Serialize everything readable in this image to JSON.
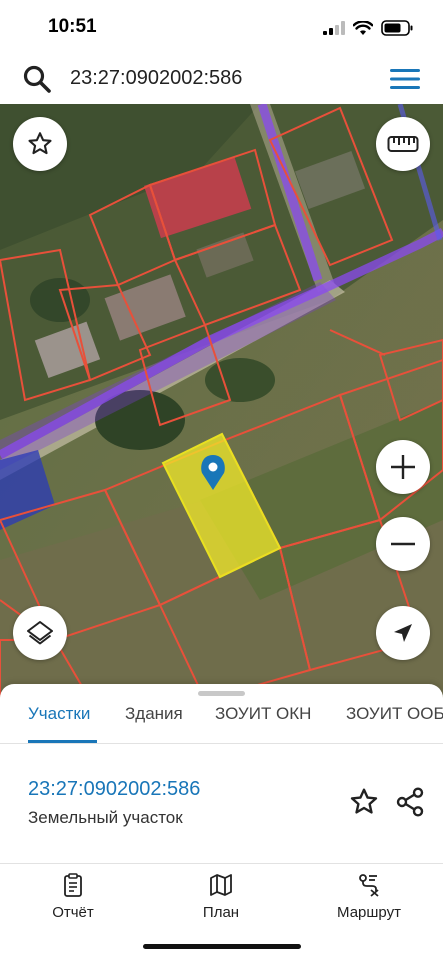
{
  "status_bar": {
    "time": "10:51"
  },
  "search": {
    "value": "23:27:0902002:586",
    "placeholder": ""
  },
  "map": {
    "controls": [
      "favorite-star",
      "ruler",
      "zoom-in",
      "zoom-out",
      "layers",
      "locate"
    ]
  },
  "tabs": [
    {
      "label": "Участки",
      "active": true
    },
    {
      "label": "Здания",
      "active": false
    },
    {
      "label": "ЗОУИТ ОКН",
      "active": false
    },
    {
      "label": "ЗОУИТ ООБ",
      "active": false
    }
  ],
  "parcel": {
    "id": "23:27:0902002:586",
    "type": "Земельный участок"
  },
  "bottom_nav": [
    {
      "label": "Отчёт",
      "icon": "report-icon"
    },
    {
      "label": "План",
      "icon": "map-plan-icon"
    },
    {
      "label": "Маршрут",
      "icon": "route-icon"
    }
  ],
  "colors": {
    "accent": "#1976b8",
    "boundary": "#e8503a",
    "selected_parcel": "#f2ea2a",
    "zone": "#7b3bd8"
  }
}
